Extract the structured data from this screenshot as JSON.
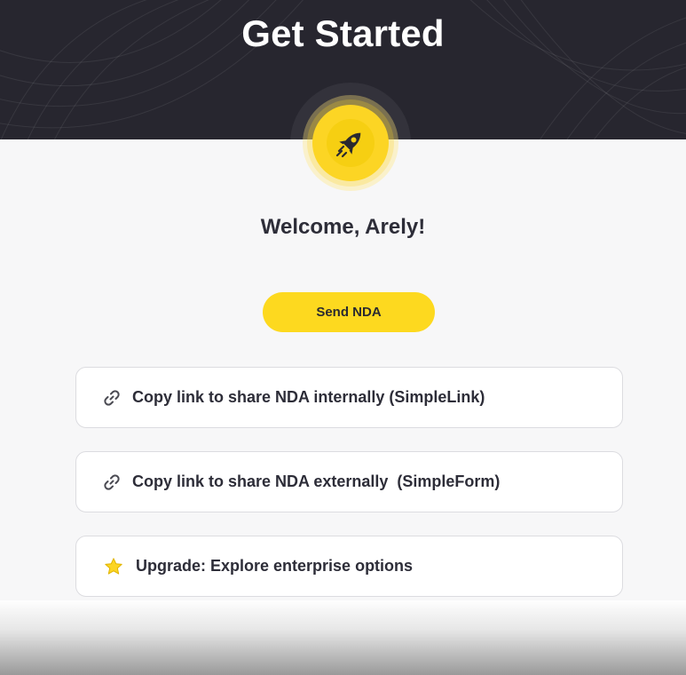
{
  "header": {
    "title": "Get Started"
  },
  "badge": {
    "icon": "rocket-icon",
    "color": "#fcd524"
  },
  "welcome": {
    "text": "Welcome, Arely!"
  },
  "send_button": {
    "label": "Send NDA",
    "color": "#fdd91f"
  },
  "options": [
    {
      "icon": "link-icon",
      "label": "Copy link to share NDA internally (SimpleLink)",
      "suffix": ""
    },
    {
      "icon": "link-icon",
      "label": "Copy link to share NDA externally",
      "suffix": "(SimpleForm)"
    },
    {
      "icon": "star-icon",
      "label": "Upgrade: Explore enterprise options",
      "suffix": ""
    }
  ],
  "colors": {
    "header_bg": "#27262f",
    "accent": "#fdd91f",
    "page_bg": "#f7f7f8"
  }
}
